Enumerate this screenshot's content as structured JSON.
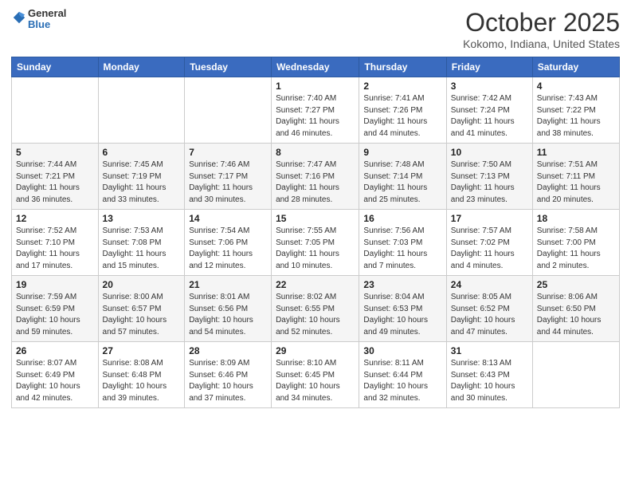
{
  "logo": {
    "general": "General",
    "blue": "Blue"
  },
  "header": {
    "month": "October 2025",
    "location": "Kokomo, Indiana, United States"
  },
  "days_of_week": [
    "Sunday",
    "Monday",
    "Tuesday",
    "Wednesday",
    "Thursday",
    "Friday",
    "Saturday"
  ],
  "weeks": [
    [
      {
        "day": "",
        "info": ""
      },
      {
        "day": "",
        "info": ""
      },
      {
        "day": "",
        "info": ""
      },
      {
        "day": "1",
        "info": "Sunrise: 7:40 AM\nSunset: 7:27 PM\nDaylight: 11 hours\nand 46 minutes."
      },
      {
        "day": "2",
        "info": "Sunrise: 7:41 AM\nSunset: 7:26 PM\nDaylight: 11 hours\nand 44 minutes."
      },
      {
        "day": "3",
        "info": "Sunrise: 7:42 AM\nSunset: 7:24 PM\nDaylight: 11 hours\nand 41 minutes."
      },
      {
        "day": "4",
        "info": "Sunrise: 7:43 AM\nSunset: 7:22 PM\nDaylight: 11 hours\nand 38 minutes."
      }
    ],
    [
      {
        "day": "5",
        "info": "Sunrise: 7:44 AM\nSunset: 7:21 PM\nDaylight: 11 hours\nand 36 minutes."
      },
      {
        "day": "6",
        "info": "Sunrise: 7:45 AM\nSunset: 7:19 PM\nDaylight: 11 hours\nand 33 minutes."
      },
      {
        "day": "7",
        "info": "Sunrise: 7:46 AM\nSunset: 7:17 PM\nDaylight: 11 hours\nand 30 minutes."
      },
      {
        "day": "8",
        "info": "Sunrise: 7:47 AM\nSunset: 7:16 PM\nDaylight: 11 hours\nand 28 minutes."
      },
      {
        "day": "9",
        "info": "Sunrise: 7:48 AM\nSunset: 7:14 PM\nDaylight: 11 hours\nand 25 minutes."
      },
      {
        "day": "10",
        "info": "Sunrise: 7:50 AM\nSunset: 7:13 PM\nDaylight: 11 hours\nand 23 minutes."
      },
      {
        "day": "11",
        "info": "Sunrise: 7:51 AM\nSunset: 7:11 PM\nDaylight: 11 hours\nand 20 minutes."
      }
    ],
    [
      {
        "day": "12",
        "info": "Sunrise: 7:52 AM\nSunset: 7:10 PM\nDaylight: 11 hours\nand 17 minutes."
      },
      {
        "day": "13",
        "info": "Sunrise: 7:53 AM\nSunset: 7:08 PM\nDaylight: 11 hours\nand 15 minutes."
      },
      {
        "day": "14",
        "info": "Sunrise: 7:54 AM\nSunset: 7:06 PM\nDaylight: 11 hours\nand 12 minutes."
      },
      {
        "day": "15",
        "info": "Sunrise: 7:55 AM\nSunset: 7:05 PM\nDaylight: 11 hours\nand 10 minutes."
      },
      {
        "day": "16",
        "info": "Sunrise: 7:56 AM\nSunset: 7:03 PM\nDaylight: 11 hours\nand 7 minutes."
      },
      {
        "day": "17",
        "info": "Sunrise: 7:57 AM\nSunset: 7:02 PM\nDaylight: 11 hours\nand 4 minutes."
      },
      {
        "day": "18",
        "info": "Sunrise: 7:58 AM\nSunset: 7:00 PM\nDaylight: 11 hours\nand 2 minutes."
      }
    ],
    [
      {
        "day": "19",
        "info": "Sunrise: 7:59 AM\nSunset: 6:59 PM\nDaylight: 10 hours\nand 59 minutes."
      },
      {
        "day": "20",
        "info": "Sunrise: 8:00 AM\nSunset: 6:57 PM\nDaylight: 10 hours\nand 57 minutes."
      },
      {
        "day": "21",
        "info": "Sunrise: 8:01 AM\nSunset: 6:56 PM\nDaylight: 10 hours\nand 54 minutes."
      },
      {
        "day": "22",
        "info": "Sunrise: 8:02 AM\nSunset: 6:55 PM\nDaylight: 10 hours\nand 52 minutes."
      },
      {
        "day": "23",
        "info": "Sunrise: 8:04 AM\nSunset: 6:53 PM\nDaylight: 10 hours\nand 49 minutes."
      },
      {
        "day": "24",
        "info": "Sunrise: 8:05 AM\nSunset: 6:52 PM\nDaylight: 10 hours\nand 47 minutes."
      },
      {
        "day": "25",
        "info": "Sunrise: 8:06 AM\nSunset: 6:50 PM\nDaylight: 10 hours\nand 44 minutes."
      }
    ],
    [
      {
        "day": "26",
        "info": "Sunrise: 8:07 AM\nSunset: 6:49 PM\nDaylight: 10 hours\nand 42 minutes."
      },
      {
        "day": "27",
        "info": "Sunrise: 8:08 AM\nSunset: 6:48 PM\nDaylight: 10 hours\nand 39 minutes."
      },
      {
        "day": "28",
        "info": "Sunrise: 8:09 AM\nSunset: 6:46 PM\nDaylight: 10 hours\nand 37 minutes."
      },
      {
        "day": "29",
        "info": "Sunrise: 8:10 AM\nSunset: 6:45 PM\nDaylight: 10 hours\nand 34 minutes."
      },
      {
        "day": "30",
        "info": "Sunrise: 8:11 AM\nSunset: 6:44 PM\nDaylight: 10 hours\nand 32 minutes."
      },
      {
        "day": "31",
        "info": "Sunrise: 8:13 AM\nSunset: 6:43 PM\nDaylight: 10 hours\nand 30 minutes."
      },
      {
        "day": "",
        "info": ""
      }
    ]
  ]
}
